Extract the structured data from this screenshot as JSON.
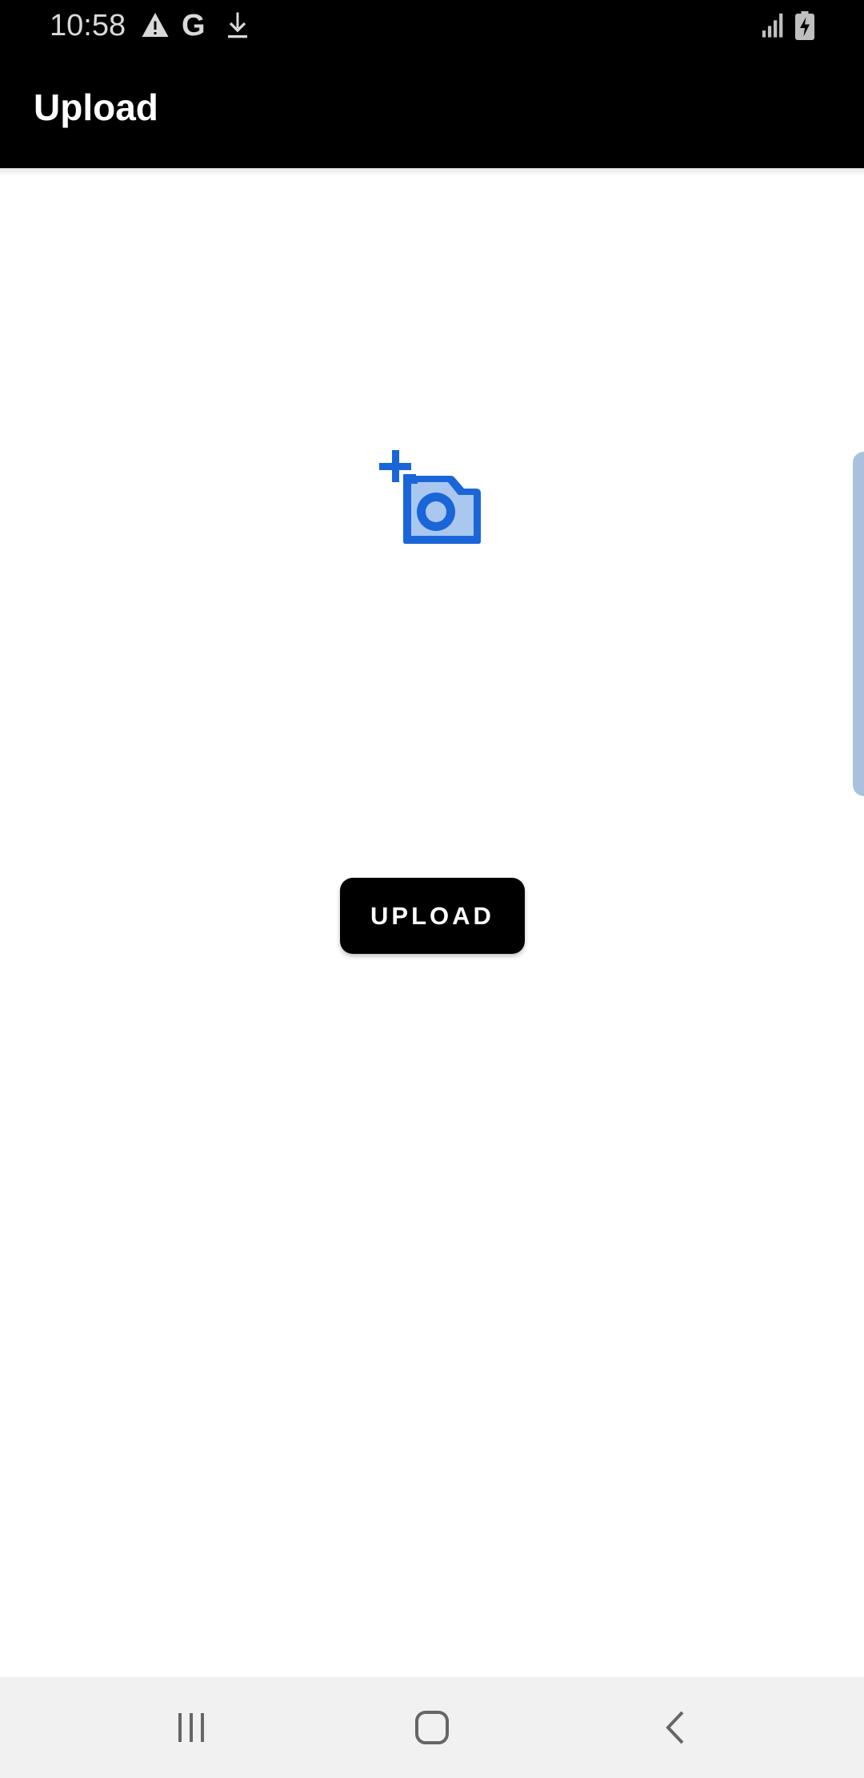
{
  "status_bar": {
    "time": "10:58",
    "g_label": "G",
    "icons": [
      "warning-icon",
      "google-icon",
      "download-icon",
      "signal-icon",
      "battery-charging-icon"
    ]
  },
  "app_bar": {
    "title": "Upload"
  },
  "main": {
    "photo_picker_icon": "add-a-photo-icon",
    "upload_button_label": "UPLOAD"
  },
  "nav_bar": {
    "icons": [
      "recent-apps-icon",
      "home-icon",
      "back-icon"
    ]
  },
  "colors": {
    "app_bar_bg": "#000000",
    "accent_blue": "#1a66d9",
    "light_blue": "#aac7f0",
    "button_bg": "#000000",
    "nav_bg": "#f1f1f1"
  }
}
